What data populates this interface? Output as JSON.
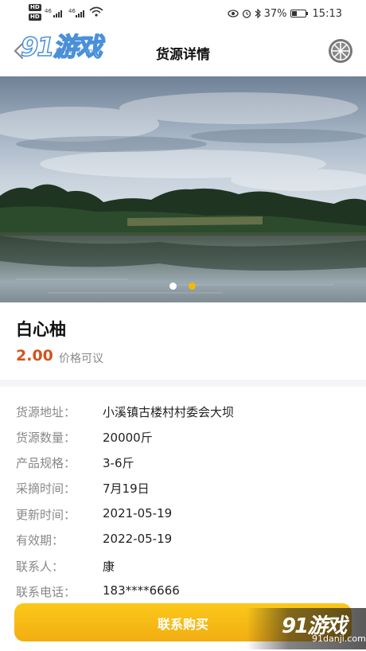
{
  "status_bar": {
    "left_labels": [
      "HD",
      "HD"
    ],
    "network": [
      "46",
      "46"
    ],
    "battery": "37%",
    "time": "15:13"
  },
  "header": {
    "title": "货源详情",
    "watermark_logo": "91游戏",
    "watermark_url": "91danji.com"
  },
  "carousel": {
    "slide_count": 2,
    "active_index": 1,
    "active_color": "#f5b800"
  },
  "product": {
    "name": "白心柚",
    "price": "2.00",
    "price_note": "价格可议"
  },
  "details": [
    {
      "label": "货源地址：",
      "value": "小溪镇古楼村村委会大坝"
    },
    {
      "label": "货源数量：",
      "value": "20000斤"
    },
    {
      "label": "产品规格：",
      "value": "3-6斤"
    },
    {
      "label": "采摘时间：",
      "value": "7月19日"
    },
    {
      "label": "更新时间：",
      "value": "2021-05-19"
    },
    {
      "label": "有效期：",
      "value": "2022-05-19"
    },
    {
      "label": "联系人：",
      "value": "康"
    },
    {
      "label": "联系电话：",
      "value": "183****6666"
    }
  ],
  "buy_button": {
    "label": "联系购买",
    "color": "#f5b800"
  },
  "watermark": {
    "logo": "91游戏",
    "url": "91danji.com"
  },
  "colors": {
    "price": "#d2541e",
    "accent": "#f5b800"
  }
}
